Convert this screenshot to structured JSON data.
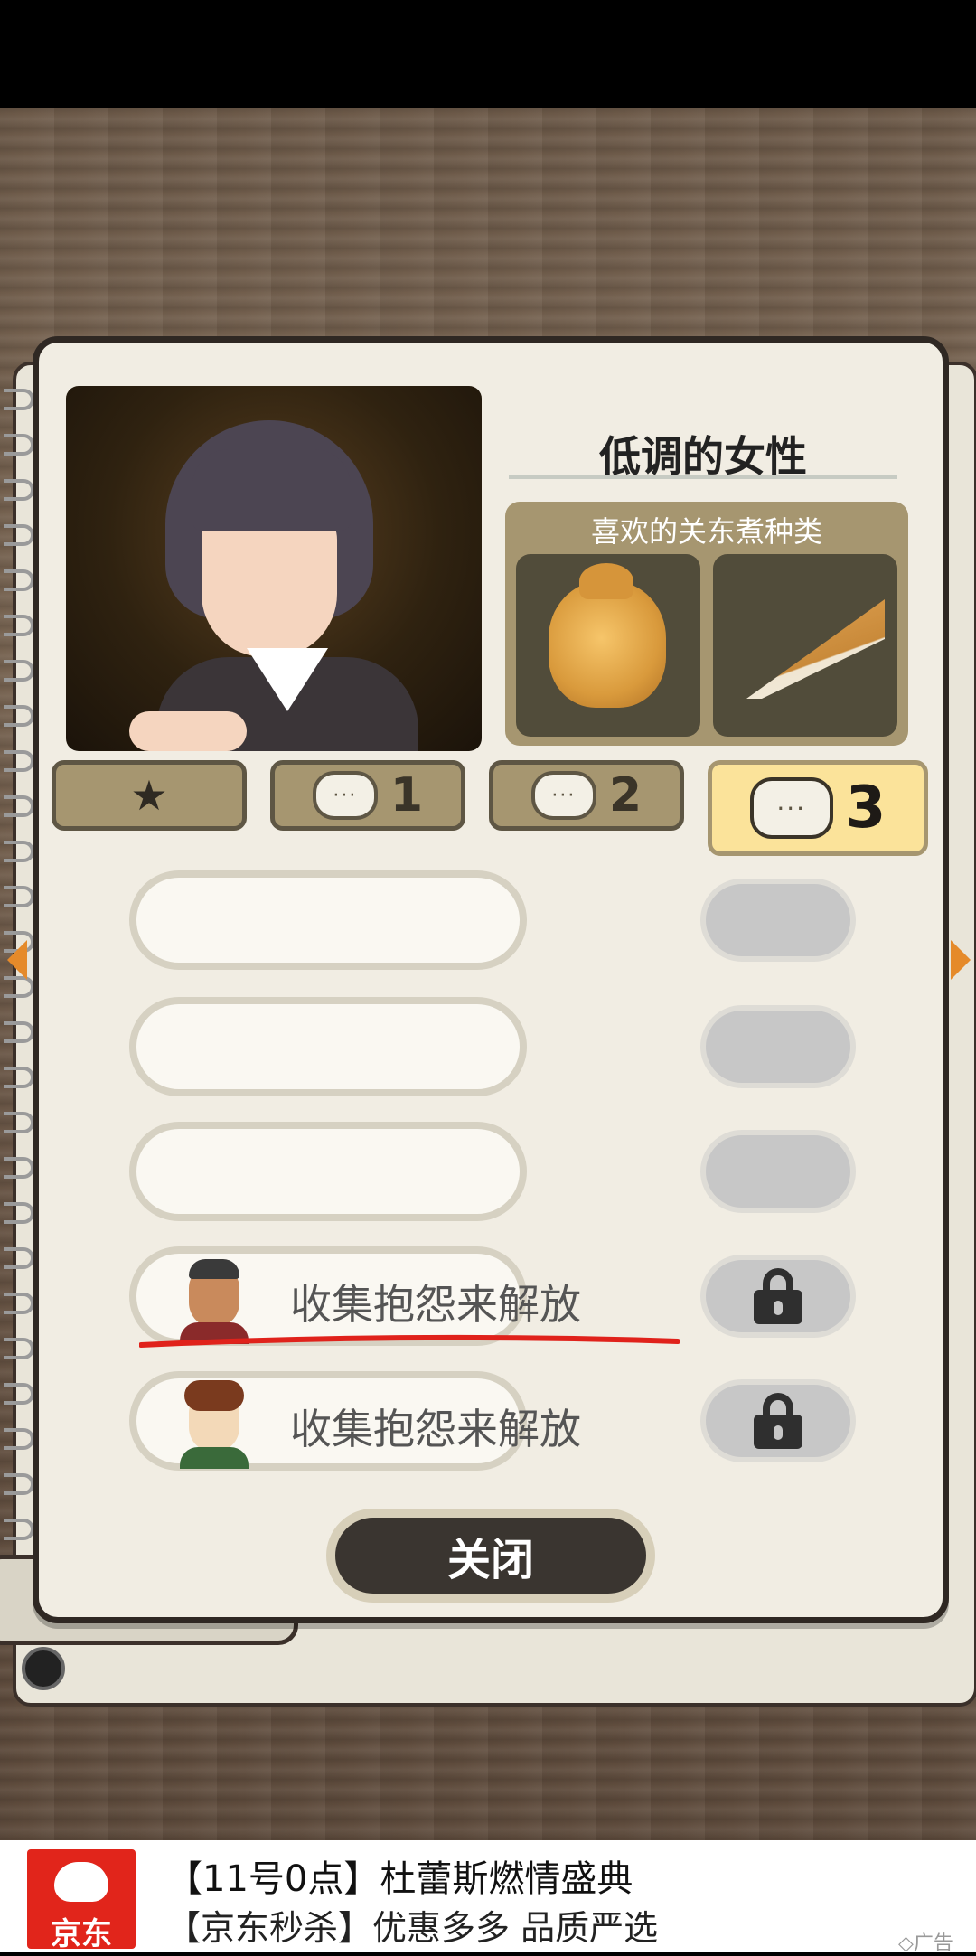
{
  "character": {
    "name": "低调的女性",
    "favorites_title": "喜欢的关东煮种类",
    "favorites": [
      {
        "icon": "fried-tofu-pouch-icon"
      },
      {
        "icon": "fried-tofu-slice-icon"
      }
    ]
  },
  "tabs": [
    {
      "icon": "star-icon",
      "label": ""
    },
    {
      "icon": "speech-bubble-icon",
      "label": "1"
    },
    {
      "icon": "speech-bubble-icon",
      "label": "2"
    },
    {
      "icon": "speech-bubble-icon",
      "label": "3",
      "active": true
    }
  ],
  "complaints": [
    {
      "text": "",
      "locked": false
    },
    {
      "text": "",
      "locked": false
    },
    {
      "text": "",
      "locked": false
    },
    {
      "text": "收集抱怨来解放",
      "locked": true,
      "avatar": "bald-man-avatar"
    },
    {
      "text": "收集抱怨来解放",
      "locked": true,
      "avatar": "curly-hair-man-avatar"
    }
  ],
  "close_label": "关闭",
  "ad": {
    "brand": "京东",
    "line1": "【11号0点】杜蕾斯燃情盛典",
    "line2": "【京东秒杀】优惠多多  品质严选",
    "tag": "广告"
  },
  "colors": {
    "tab_active": "#fbe39a",
    "tab_inactive": "#a69670",
    "annotation_underline": "#e0221b",
    "close_button": "#3a3530"
  }
}
